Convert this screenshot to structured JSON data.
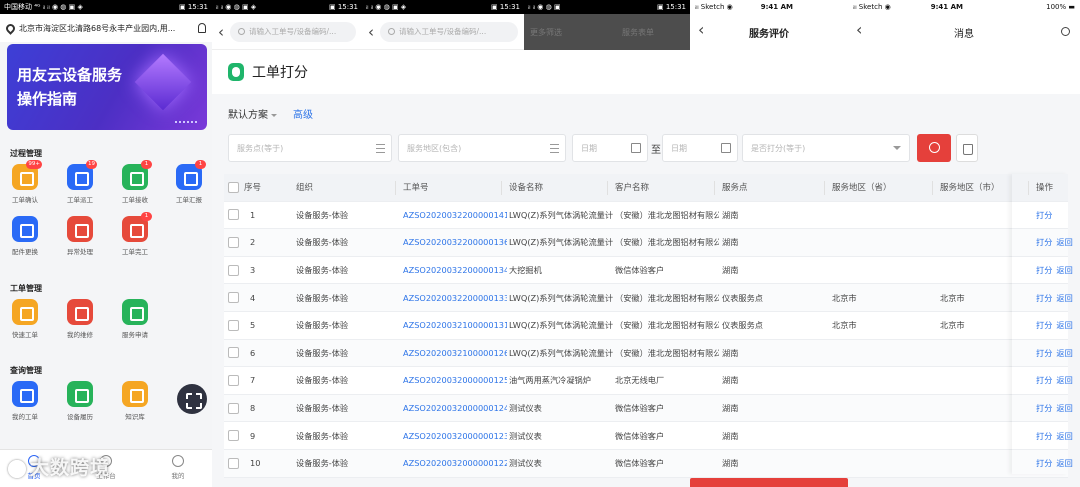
{
  "status_left": {
    "left": "中国移动 ⁴ᴳ ᵢₗ ᵢₗ ◉ ◍ ▣ ◈",
    "right": "▣ 15:31"
  },
  "status_strips": [
    {
      "left": "ᵢₗ ᵢₗ ◉ ◍ ▣ ◈",
      "right": "▣ 15:31"
    },
    {
      "left": "ᵢₗ ᵢₗ ◉ ◍ ▣ ◈",
      "right": "▣ 15:31"
    },
    {
      "left": "ᵢₗ ᵢₗ ◉ ◍ ▣",
      "right": "▣ 15:31"
    }
  ],
  "left_app": {
    "location": "北京市海淀区北清路68号永丰产业园内,用...",
    "banner": {
      "line1": "用友云设备服务",
      "line2": "操作指南"
    },
    "sections": [
      {
        "title": "过程管理",
        "items": [
          {
            "label": "工单确认",
            "color": "#f5a623",
            "badge": "99+"
          },
          {
            "label": "工单派工",
            "color": "#2a6af6",
            "badge": "19"
          },
          {
            "label": "工单接收",
            "color": "#27b35a",
            "badge": "1"
          },
          {
            "label": "工单汇报",
            "color": "#2a6af6",
            "badge": "1"
          },
          {
            "label": "配件更换",
            "color": "#2a6af6",
            "badge": ""
          },
          {
            "label": "异常处理",
            "color": "#e64a3b",
            "badge": ""
          },
          {
            "label": "工单完工",
            "color": "#e64a3b",
            "badge": "1"
          }
        ]
      },
      {
        "title": "工单管理",
        "items": [
          {
            "label": "快速工单",
            "color": "#f5a623",
            "badge": ""
          },
          {
            "label": "我的维修",
            "color": "#e64a3b",
            "badge": ""
          },
          {
            "label": "服务申请",
            "color": "#27b35a",
            "badge": ""
          }
        ]
      },
      {
        "title": "查询管理",
        "items": [
          {
            "label": "我的工单",
            "color": "#2a6af6",
            "badge": ""
          },
          {
            "label": "设备履历",
            "color": "#27b35a",
            "badge": ""
          },
          {
            "label": "知识库",
            "color": "#f5a623",
            "badge": ""
          }
        ]
      }
    ],
    "tabs": [
      {
        "label": "首页",
        "active": true
      },
      {
        "label": "工作台",
        "active": false
      },
      {
        "label": "我的",
        "active": false
      }
    ],
    "watermark": "大数跨境"
  },
  "strips": [
    {
      "placeholder": "请输入工单号/设备编码/..."
    },
    {
      "placeholder": "请输入工单号/设备编码/..."
    }
  ],
  "gray_overlay": {
    "text1": "更多筛选",
    "text2": "服务表单"
  },
  "main": {
    "title": "工单打分",
    "scheme": "默认方案",
    "advanced": "高级",
    "filters": {
      "service_point": "服务点(等于)",
      "service_region": "服务地区(包含)",
      "date_from": "日期",
      "range_sep": "至",
      "date_to": "日期",
      "scored": "是否打分(等于)"
    },
    "columns": [
      "序号",
      "组织",
      "工单号",
      "设备名称",
      "客户名称",
      "服务点",
      "服务地区（省）",
      "服务地区（市）",
      "操作"
    ],
    "op_score": "打分",
    "op_back": "返回",
    "rows": [
      {
        "no": "1",
        "org": "设备服务-体验",
        "order": "AZSO2020032200000141",
        "device": "LWQ(Z)系列气体涡轮流量计",
        "customer": "（安徽）淮北龙图铝材有限公司",
        "point": "湖南",
        "prov": "",
        "city": "",
        "back": false
      },
      {
        "no": "2",
        "org": "设备服务-体验",
        "order": "AZSO2020032200000136",
        "device": "LWQ(Z)系列气体涡轮流量计",
        "customer": "（安徽）淮北龙图铝材有限公司",
        "point": "湖南",
        "prov": "",
        "city": "",
        "back": true
      },
      {
        "no": "3",
        "org": "设备服务-体验",
        "order": "AZSO2020032200000134",
        "device": "大挖掘机",
        "customer": "微信体验客户",
        "point": "湖南",
        "prov": "",
        "city": "",
        "back": true
      },
      {
        "no": "4",
        "org": "设备服务-体验",
        "order": "AZSO2020032200000133",
        "device": "LWQ(Z)系列气体涡轮流量计",
        "customer": "（安徽）淮北龙图铝材有限公司",
        "point": "仪表服务点",
        "prov": "北京市",
        "city": "北京市",
        "back": true
      },
      {
        "no": "5",
        "org": "设备服务-体验",
        "order": "AZSO2020032100000131",
        "device": "LWQ(Z)系列气体涡轮流量计",
        "customer": "（安徽）淮北龙图铝材有限公司",
        "point": "仪表服务点",
        "prov": "北京市",
        "city": "北京市",
        "back": true
      },
      {
        "no": "6",
        "org": "设备服务-体验",
        "order": "AZSO2020032100000126",
        "device": "LWQ(Z)系列气体涡轮流量计",
        "customer": "（安徽）淮北龙图铝材有限公司",
        "point": "湖南",
        "prov": "",
        "city": "",
        "back": true
      },
      {
        "no": "7",
        "org": "设备服务-体验",
        "order": "AZSO2020032000000125",
        "device": "油气两用蒸汽冷凝锅炉",
        "customer": "北京无线电厂",
        "point": "湖南",
        "prov": "",
        "city": "",
        "back": true
      },
      {
        "no": "8",
        "org": "设备服务-体验",
        "order": "AZSO2020032000000124",
        "device": "测试仪表",
        "customer": "微信体验客户",
        "point": "湖南",
        "prov": "",
        "city": "",
        "back": true
      },
      {
        "no": "9",
        "org": "设备服务-体验",
        "order": "AZSO2020032000000123",
        "device": "测试仪表",
        "customer": "微信体验客户",
        "point": "湖南",
        "prov": "",
        "city": "",
        "back": true
      },
      {
        "no": "10",
        "org": "设备服务-体验",
        "order": "AZSO2020032000000122",
        "device": "测试仪表",
        "customer": "微信体验客户",
        "point": "湖南",
        "prov": "",
        "city": "",
        "back": true
      }
    ]
  },
  "right_phones": [
    {
      "carrier": "ᵢₗₗ Sketch ◉",
      "time": "9:41 AM",
      "battery": "",
      "title": "服务评价"
    },
    {
      "carrier": "ᵢₗₗ Sketch ◉",
      "time": "9:41 AM",
      "battery": "100% ▬",
      "title": "消息"
    }
  ]
}
